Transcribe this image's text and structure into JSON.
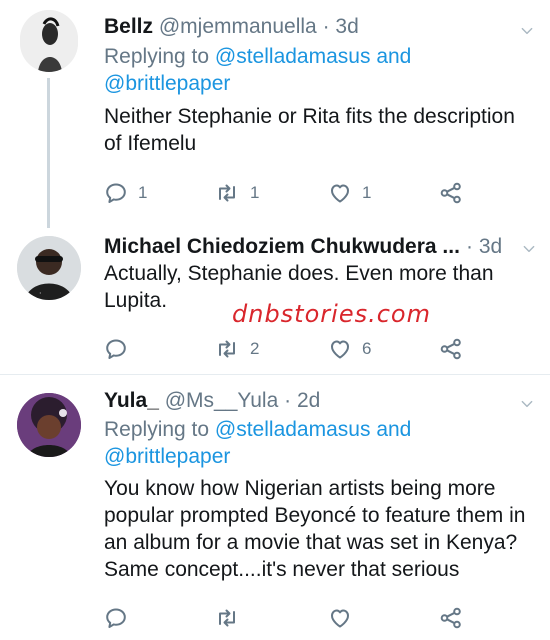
{
  "watermark": "dnbstories.com",
  "tweets": [
    {
      "name": "Bellz",
      "handle": "@mjemmanuella",
      "sep": "·",
      "time": "3d",
      "replying_prefix": "Replying to",
      "replying_mention_1": "@stelladamasus",
      "replying_and": "and",
      "replying_mention_2": "@brittlepaper",
      "text": "Neither Stephanie or Rita fits the description of Ifemelu",
      "replies": "1",
      "retweets": "1",
      "likes": "1"
    },
    {
      "name": "Michael Chiedoziem Chukwudera ...",
      "sep": "·",
      "time": "3d",
      "text": "Actually, Stephanie does. Even more than Lupita.",
      "replies": "",
      "retweets": "2",
      "likes": "6"
    },
    {
      "name": "Yula_",
      "handle": "@Ms__Yula",
      "sep": "·",
      "time": "2d",
      "replying_prefix": "Replying to",
      "replying_mention_1": "@stelladamasus",
      "replying_and": "and",
      "replying_mention_2": "@brittlepaper",
      "text": "You know how Nigerian artists being more popular prompted Beyoncé to feature them in an album for a movie that was set in Kenya? Same concept....it's never that serious",
      "replies": "",
      "retweets": "",
      "likes": ""
    }
  ],
  "icons": {
    "reply": "reply-icon",
    "retweet": "retweet-icon",
    "like": "heart-icon",
    "share": "share-icon",
    "more": "chevron-down-icon"
  },
  "colors": {
    "link": "#1b95e0",
    "secondary_text": "#657786",
    "thread_line": "#ccd6dd",
    "divider": "#e6ecf0",
    "watermark": "#d9262c"
  }
}
